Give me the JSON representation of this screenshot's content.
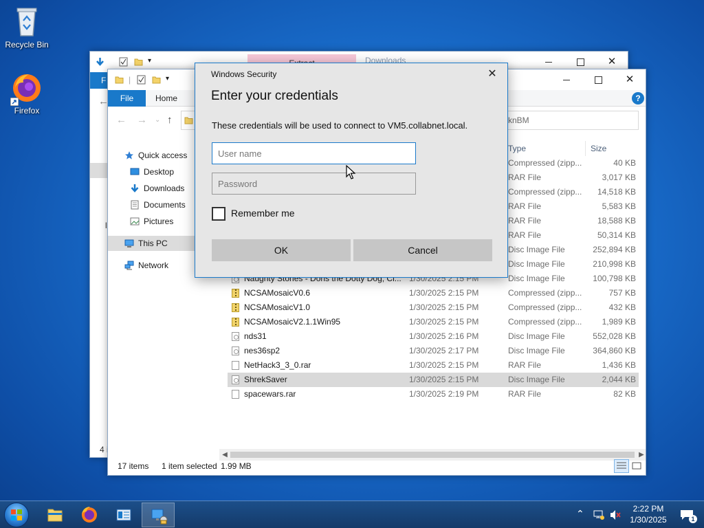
{
  "desktop": {
    "icons": [
      {
        "label": "Recycle Bin",
        "icon": "recycle-bin-icon"
      },
      {
        "label": "Firefox",
        "icon": "firefox-icon"
      }
    ]
  },
  "back_window": {
    "tab_extract": "Extract",
    "tab_title": "Downloads",
    "tab_file_fragment": "F",
    "status_fragment": "4 i",
    "side_fragment": "l"
  },
  "front_window": {
    "tabs": {
      "file": "File",
      "home": "Home"
    },
    "help": "?",
    "search_fragment": "knBM",
    "nav": [
      {
        "label": "Quick access",
        "icon": "star-icon"
      },
      {
        "label": "Desktop",
        "icon": "desktop-icon"
      },
      {
        "label": "Downloads",
        "icon": "download-icon"
      },
      {
        "label": "Documents",
        "icon": "documents-icon"
      },
      {
        "label": "Pictures",
        "icon": "pictures-icon"
      },
      {
        "label": "This PC",
        "icon": "computer-icon"
      },
      {
        "label": "Network",
        "icon": "network-icon"
      }
    ],
    "columns": {
      "type": "Type",
      "size": "Size"
    },
    "rows": [
      {
        "name": "",
        "date": "",
        "type": "Compressed (zipp...",
        "size": "40 KB",
        "icon": "zip-icon",
        "partial": true
      },
      {
        "name": "",
        "date": "",
        "type": "RAR File",
        "size": "3,017 KB",
        "icon": "file-icon",
        "partial": true
      },
      {
        "name": "",
        "date": "",
        "type": "Compressed (zipp...",
        "size": "14,518 KB",
        "icon": "zip-icon",
        "partial": true
      },
      {
        "name": "",
        "date": "",
        "type": "RAR File",
        "size": "5,583 KB",
        "icon": "file-icon",
        "partial": true
      },
      {
        "name": "",
        "date": "",
        "type": "RAR File",
        "size": "18,588 KB",
        "icon": "file-icon",
        "partial": true
      },
      {
        "name": "",
        "date": "",
        "type": "RAR File",
        "size": "50,314 KB",
        "icon": "file-icon",
        "partial": true
      },
      {
        "name": "",
        "date": "",
        "type": "Disc Image File",
        "size": "252,894 KB",
        "icon": "image-icon",
        "partial": true
      },
      {
        "name": "",
        "date": "",
        "type": "Disc Image File",
        "size": "210,998 KB",
        "icon": "image-icon",
        "partial": true
      },
      {
        "name": "Naughty Stories - Doris the Dotty Dog, Cl...",
        "date": "1/30/2025 2:15 PM",
        "type": "Disc Image File",
        "size": "100,798 KB",
        "icon": "image-icon"
      },
      {
        "name": "NCSAMosaicV0.6",
        "date": "1/30/2025 2:15 PM",
        "type": "Compressed (zipp...",
        "size": "757 KB",
        "icon": "zip-icon"
      },
      {
        "name": "NCSAMosaicV1.0",
        "date": "1/30/2025 2:15 PM",
        "type": "Compressed (zipp...",
        "size": "432 KB",
        "icon": "zip-icon"
      },
      {
        "name": "NCSAMosaicV2.1.1Win95",
        "date": "1/30/2025 2:15 PM",
        "type": "Compressed (zipp...",
        "size": "1,989 KB",
        "icon": "zip-icon"
      },
      {
        "name": "nds31",
        "date": "1/30/2025 2:16 PM",
        "type": "Disc Image File",
        "size": "552,028 KB",
        "icon": "image-icon"
      },
      {
        "name": "nes36sp2",
        "date": "1/30/2025 2:17 PM",
        "type": "Disc Image File",
        "size": "364,860 KB",
        "icon": "image-icon"
      },
      {
        "name": "NetHack3_3_0.rar",
        "date": "1/30/2025 2:15 PM",
        "type": "RAR File",
        "size": "1,436 KB",
        "icon": "file-icon"
      },
      {
        "name": "ShrekSaver",
        "date": "1/30/2025 2:15 PM",
        "type": "Disc Image File",
        "size": "2,044 KB",
        "icon": "image-icon",
        "selected": true
      },
      {
        "name": "spacewars.rar",
        "date": "1/30/2025 2:19 PM",
        "type": "RAR File",
        "size": "82 KB",
        "icon": "file-icon"
      }
    ],
    "status": {
      "items": "17 items",
      "selected": "1 item selected",
      "size": "1.99 MB"
    }
  },
  "dialog": {
    "caption": "Windows Security",
    "heading": "Enter your credentials",
    "message": "These credentials will be used to connect to VM5.collabnet.local.",
    "username_placeholder": "User name",
    "password_placeholder": "Password",
    "remember_label": "Remember me",
    "ok_label": "OK",
    "cancel_label": "Cancel"
  },
  "taskbar": {
    "apps": [
      {
        "name": "file-explorer-icon",
        "active": false
      },
      {
        "name": "firefox-icon",
        "active": false
      },
      {
        "name": "server-manager-icon",
        "active": false
      },
      {
        "name": "windows-security-icon",
        "active": true
      }
    ],
    "time": "2:22 PM",
    "date": "1/30/2025",
    "notifications": "1"
  },
  "colors": {
    "accent": "#1979ca",
    "taskbar": "#143a69",
    "dialog_bg": "#e6e6e6",
    "button": "#c6c6c6"
  }
}
